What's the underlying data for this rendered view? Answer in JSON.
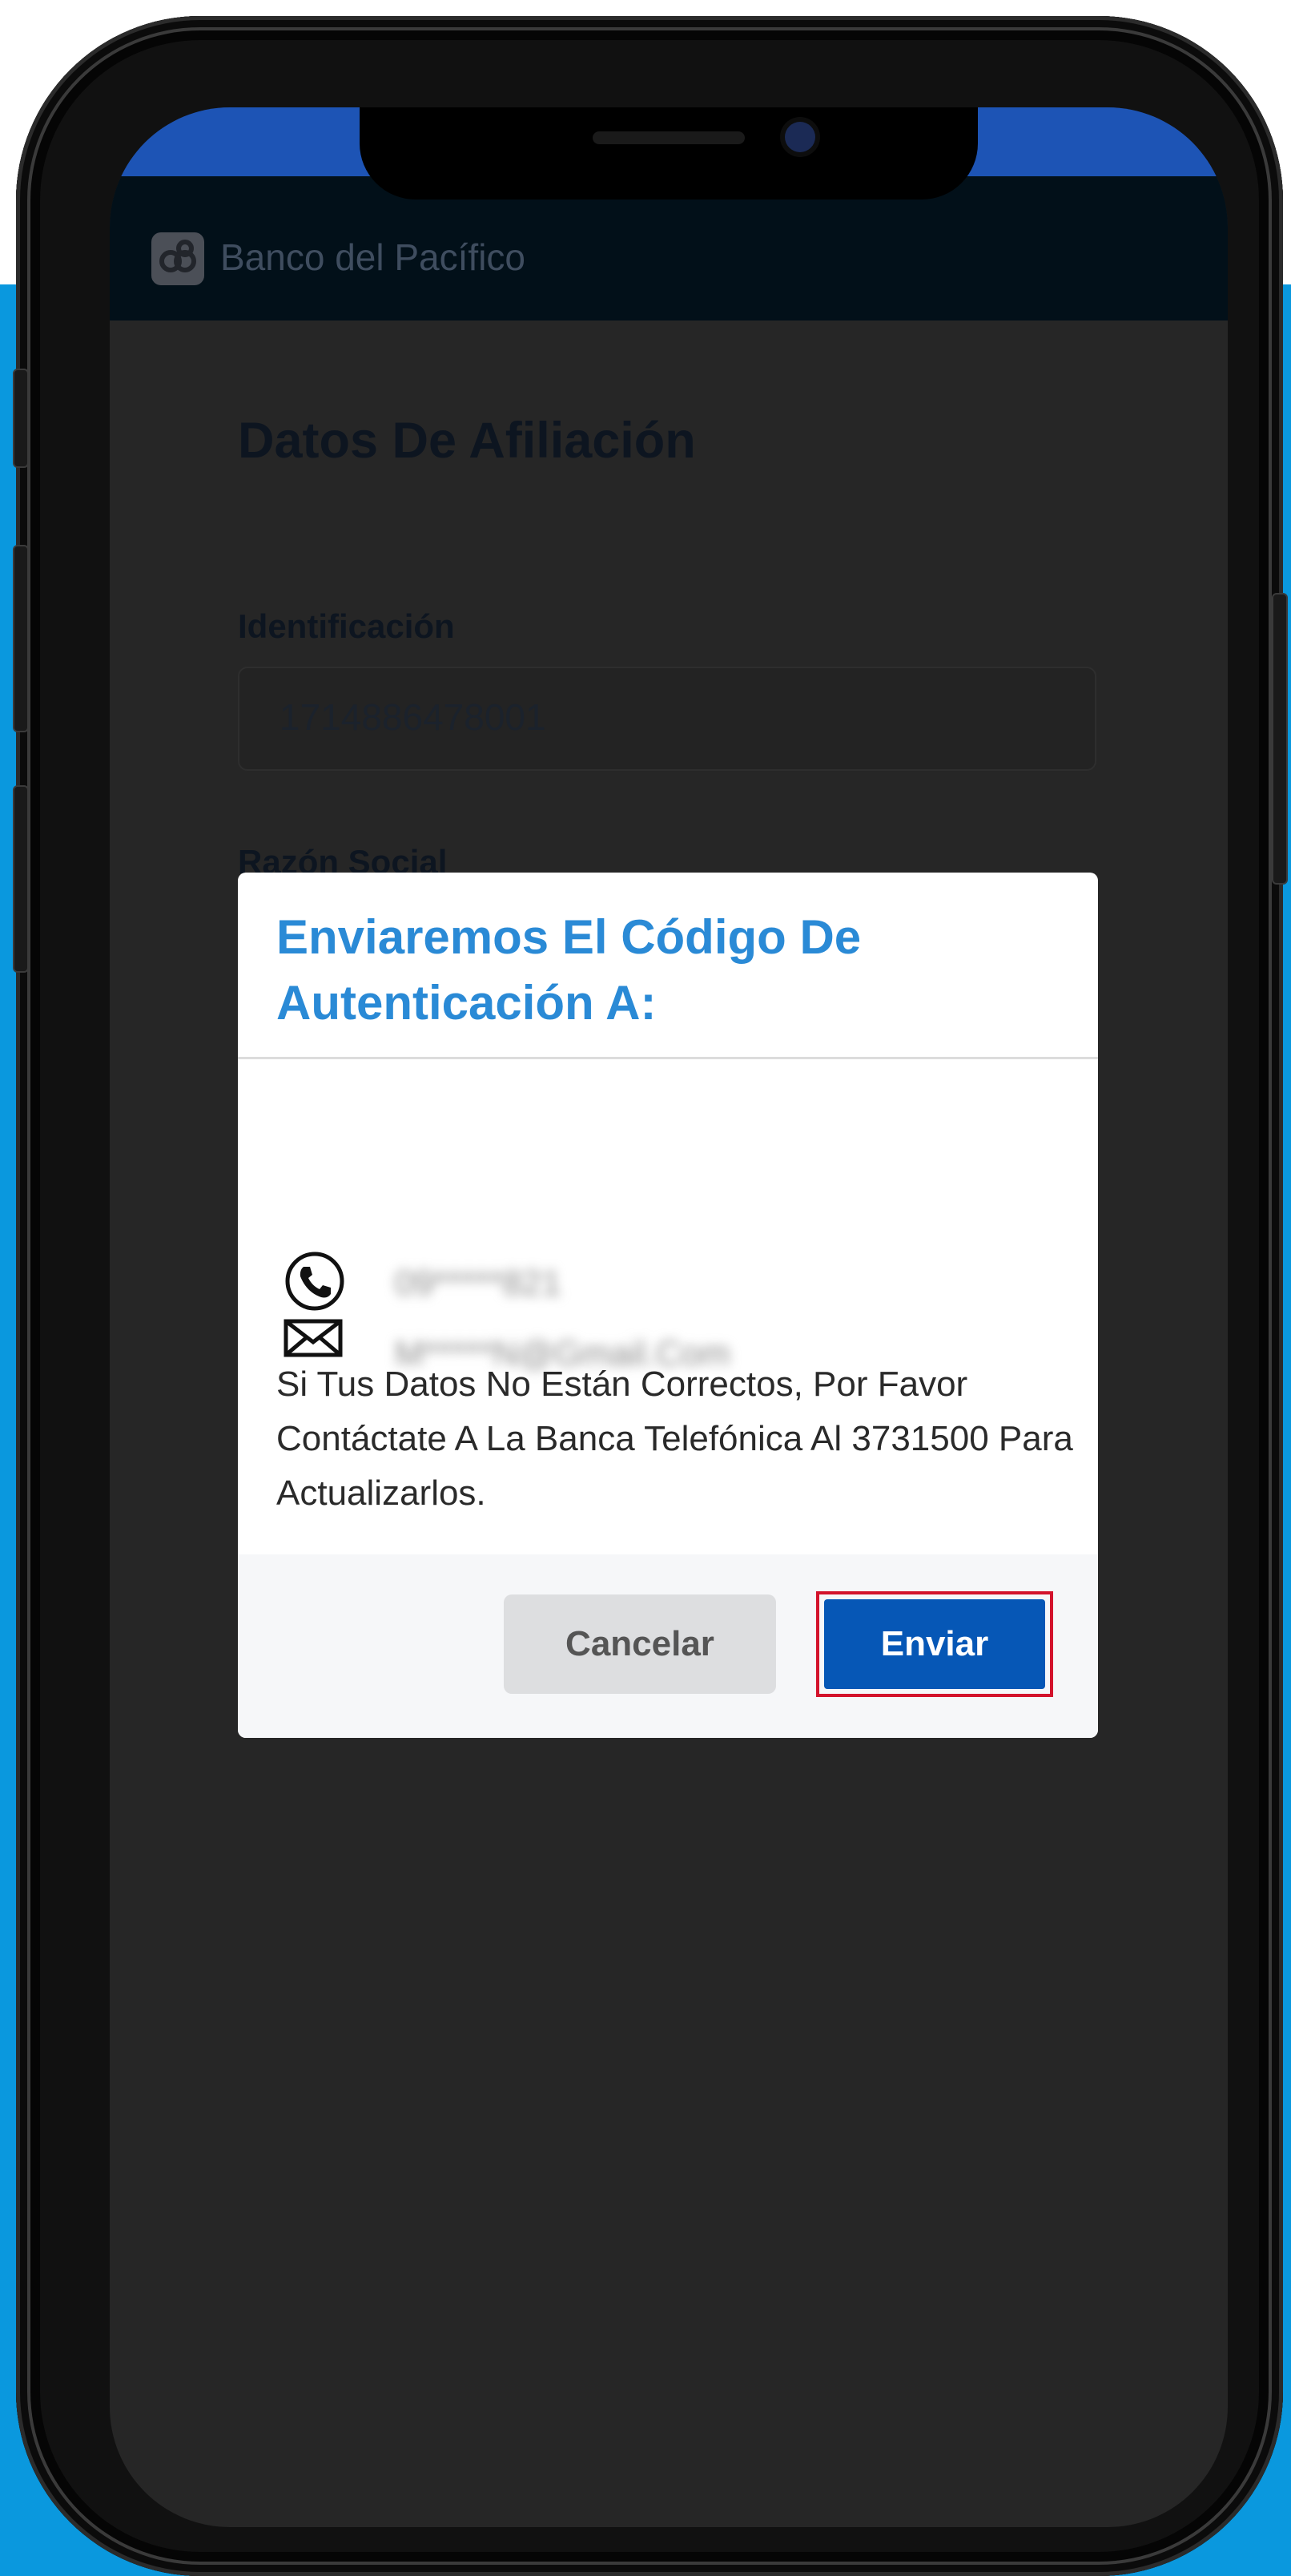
{
  "app": {
    "name": "Banco del Pacífico"
  },
  "page": {
    "title": "Datos De Afiliación",
    "fields": [
      {
        "label": "Identificación",
        "value": "1714886478001"
      },
      {
        "label": "Razón Social"
      }
    ]
  },
  "dialog": {
    "title": "Enviaremos El Código De Autenticación A:",
    "contacts": [
      {
        "icon": "phone-icon",
        "value": "09*****821"
      },
      {
        "icon": "envelope-icon",
        "value": "M*****N@Gmail.Com"
      }
    ],
    "message": "Si Tus Datos No Están Correctos, Por Favor Contáctate A La Banca Telefónica Al 3731500 Para Actualizarlos.",
    "buttons": {
      "cancel": "Cancelar",
      "send": "Enviar"
    }
  },
  "colors": {
    "brand_blue": "#0657b6",
    "title_blue": "#2a8ad6",
    "highlight": "#d3132c",
    "background_blue": "#0a98de"
  }
}
